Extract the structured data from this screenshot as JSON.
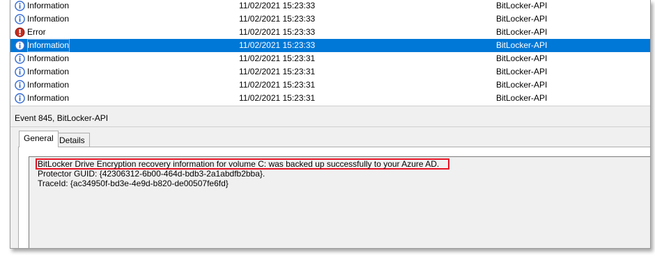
{
  "event_list": [
    {
      "level": "Information",
      "icon": "info-icon",
      "date": "11/02/2021 15:23:33",
      "source": "BitLocker-API",
      "selected": false
    },
    {
      "level": "Information",
      "icon": "info-icon",
      "date": "11/02/2021 15:23:33",
      "source": "BitLocker-API",
      "selected": false
    },
    {
      "level": "Error",
      "icon": "error-icon",
      "date": "11/02/2021 15:23:33",
      "source": "BitLocker-API",
      "selected": false
    },
    {
      "level": "Information",
      "icon": "info-icon",
      "date": "11/02/2021 15:23:33",
      "source": "BitLocker-API",
      "selected": true
    },
    {
      "level": "Information",
      "icon": "info-icon",
      "date": "11/02/2021 15:23:31",
      "source": "BitLocker-API",
      "selected": false
    },
    {
      "level": "Information",
      "icon": "info-icon",
      "date": "11/02/2021 15:23:31",
      "source": "BitLocker-API",
      "selected": false
    },
    {
      "level": "Information",
      "icon": "info-icon",
      "date": "11/02/2021 15:23:31",
      "source": "BitLocker-API",
      "selected": false
    },
    {
      "level": "Information",
      "icon": "info-icon",
      "date": "11/02/2021 15:23:31",
      "source": "BitLocker-API",
      "selected": false
    }
  ],
  "event_details": {
    "title": "Event 845, BitLocker-API",
    "tabs": [
      {
        "label": "General",
        "active": true
      },
      {
        "label": "Details",
        "active": false
      }
    ],
    "description_lines": [
      "BitLocker Drive Encryption recovery information for volume C: was backed up successfully to your Azure AD.",
      "Protector GUID: {42306312-6b00-464d-bdb3-2a1abdfb2bba}.",
      "TraceId: {ac34950f-bd3e-4e9d-b820-de00507fe6fd}"
    ]
  },
  "colors": {
    "selection": "#0078d7",
    "highlight_box": "#e81123",
    "info_icon": "#3b6fd4",
    "error_icon": "#c42b1c"
  }
}
